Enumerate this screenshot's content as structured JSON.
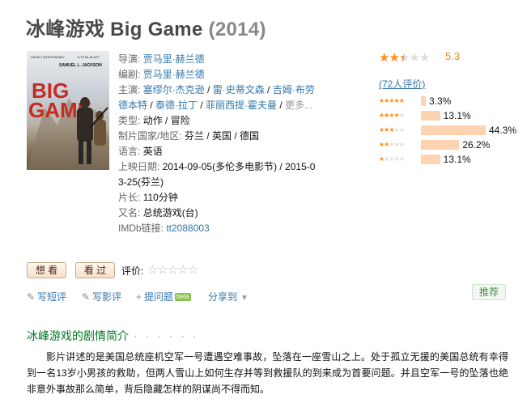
{
  "title": {
    "name": "冰峰游戏 Big Game",
    "year": "(2014)"
  },
  "poster": {
    "tagline_left": "\"HUGELY ENTERTAINING\"",
    "tagline_right": "\"A TOTAL BLAST\"",
    "actor": "SAMUEL L. JACKSON",
    "word1": "BIG",
    "word2": "GAME"
  },
  "info": {
    "director_label": "导演",
    "directors": "贾马里·赫兰德",
    "writer_label": "编剧",
    "writers": "贾马里·赫兰德",
    "cast_label": "主演",
    "cast": [
      "塞缪尔·杰克逊",
      "雷·史蒂文森",
      "吉姆·布劳",
      "德本特",
      "泰德·拉丁",
      "菲丽西提·霍夫曼"
    ],
    "cast_more": "更多...",
    "genre_label": "类型",
    "genres": "动作 / 冒险",
    "country_label": "制片国家/地区",
    "country": "芬兰 / 英国 / 德国",
    "language_label": "语言",
    "language": "英语",
    "release_label": "上映日期",
    "release": "2014-09-05(多伦多电影节) / 2015-03-25(芬兰)",
    "runtime_label": "片长",
    "runtime": "110分钟",
    "aka_label": "又名",
    "aka": "总统游戏(台)",
    "imdb_label": "IMDb链接",
    "imdb": "tt2088003"
  },
  "rating": {
    "score": "5.3",
    "count_text": "(72人评价)",
    "stars": 2.5,
    "distribution": [
      {
        "stars": 5,
        "percent": 3.3,
        "label": "3.3%"
      },
      {
        "stars": 4,
        "percent": 13.1,
        "label": "13.1%"
      },
      {
        "stars": 3,
        "percent": 44.3,
        "label": "44.3%"
      },
      {
        "stars": 2,
        "percent": 26.2,
        "label": "26.2%"
      },
      {
        "stars": 1,
        "percent": 13.1,
        "label": "13.1%"
      }
    ],
    "accent_color": "#ff8c1a",
    "bar_color": "#ffd3b0"
  },
  "user_actions": {
    "want_label": "想 看",
    "seen_label": "看 过",
    "rate_label": "评价:"
  },
  "action_links": [
    {
      "icon": "pencil-icon",
      "label": "写短评"
    },
    {
      "icon": "pencil-icon",
      "label": "写影评"
    },
    {
      "icon": "plus-icon",
      "label": "提问题"
    }
  ],
  "beta_badge": "beta",
  "share_label": "分享到",
  "recommend_label": "推荐",
  "summary": {
    "heading": "冰峰游戏的剧情简介",
    "dots": "· · · · · ·",
    "text": "影片讲述的是美国总统座机空军一号遭遇空难事故，坠落在一座雪山之上。处于孤立无援的美国总统有幸得到一名13岁小男孩的救助，但两人雪山上如何生存并等到救援队的到来成为首要问题。并且空军一号的坠落也绝非意外事故那么简单，背后隐藏怎样的阴谋尚不得而知。"
  }
}
